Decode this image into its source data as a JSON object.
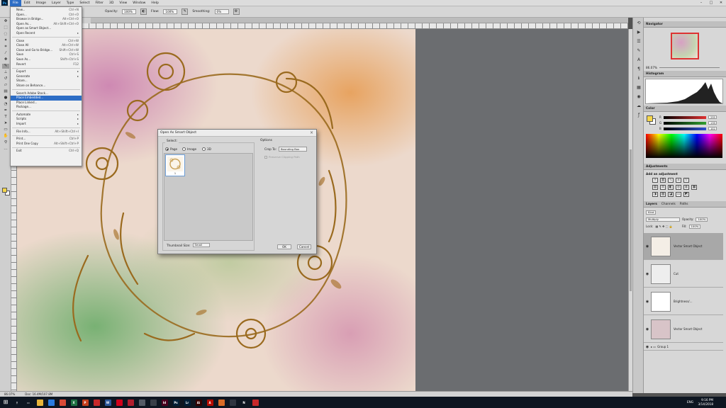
{
  "menubar": {
    "logo": "Ps",
    "items": [
      "File",
      "Edit",
      "Image",
      "Layer",
      "Type",
      "Select",
      "Filter",
      "3D",
      "View",
      "Window",
      "Help"
    ],
    "active_index": 0
  },
  "window_controls": {
    "minimize": "–",
    "maximize": "□",
    "close": "✕"
  },
  "options_bar": {
    "opacity_label": "Opacity:",
    "opacity_value": "100%",
    "flow_label": "Flow:",
    "flow_value": "100%",
    "smoothing_label": "Smoothing:",
    "smoothing_value": "0%"
  },
  "document_tab": "",
  "status_bar": {
    "zoom": "86.07%",
    "doc": "Doc: 16.4M/107.8M"
  },
  "file_menu": [
    {
      "label": "New...",
      "shortcut": "Ctrl+N"
    },
    {
      "label": "Open...",
      "shortcut": "Ctrl+O"
    },
    {
      "label": "Browse in Bridge...",
      "shortcut": "Alt+Ctrl+O"
    },
    {
      "label": "Open As...",
      "shortcut": "Alt+Shift+Ctrl+O"
    },
    {
      "label": "Open as Smart Object...",
      "shortcut": ""
    },
    {
      "label": "Open Recent",
      "shortcut": "▸"
    },
    {
      "sep": true
    },
    {
      "label": "Close",
      "shortcut": "Ctrl+W"
    },
    {
      "label": "Close All",
      "shortcut": "Alt+Ctrl+W"
    },
    {
      "label": "Close and Go to Bridge...",
      "shortcut": "Shift+Ctrl+W"
    },
    {
      "label": "Save",
      "shortcut": "Ctrl+S"
    },
    {
      "label": "Save As...",
      "shortcut": "Shift+Ctrl+S"
    },
    {
      "label": "Revert",
      "shortcut": "F12"
    },
    {
      "sep": true
    },
    {
      "label": "Export",
      "shortcut": "▸"
    },
    {
      "label": "Generate",
      "shortcut": "▸"
    },
    {
      "label": "Share...",
      "shortcut": ""
    },
    {
      "label": "Share on Behance...",
      "shortcut": ""
    },
    {
      "sep": true
    },
    {
      "label": "Search Adobe Stock...",
      "shortcut": ""
    },
    {
      "label": "Place Embedded...",
      "shortcut": "",
      "highlight": true
    },
    {
      "label": "Place Linked...",
      "shortcut": ""
    },
    {
      "label": "Package...",
      "shortcut": ""
    },
    {
      "sep": true
    },
    {
      "label": "Automate",
      "shortcut": "▸"
    },
    {
      "label": "Scripts",
      "shortcut": "▸"
    },
    {
      "label": "Import",
      "shortcut": "▸"
    },
    {
      "sep": true
    },
    {
      "label": "File Info...",
      "shortcut": "Alt+Shift+Ctrl+I"
    },
    {
      "sep": true
    },
    {
      "label": "Print...",
      "shortcut": "Ctrl+P"
    },
    {
      "label": "Print One Copy",
      "shortcut": "Alt+Shift+Ctrl+P"
    },
    {
      "sep": true
    },
    {
      "label": "Exit",
      "shortcut": "Ctrl+Q"
    }
  ],
  "dialog": {
    "title": "Open As Smart Object",
    "select_label": "Select:",
    "radios": [
      {
        "label": "Page",
        "checked": true
      },
      {
        "label": "Image",
        "checked": false
      },
      {
        "label": "3D",
        "checked": false
      }
    ],
    "thumb_number": "1",
    "thumb_size_label": "Thumbnail Size:",
    "thumb_size_value": "Small",
    "options_label": "Options",
    "crop_label": "Crop To:",
    "crop_value": "Bounding Box",
    "clip_label": "Preserve Clipping Path",
    "ok": "OK",
    "cancel": "Cancel"
  },
  "panels": {
    "navigator": {
      "title": "Navigator",
      "zoom": "86.07%"
    },
    "histogram": {
      "title": "Histogram"
    },
    "color": {
      "title": "Color",
      "rows": [
        {
          "label": "R",
          "value": "255",
          "color": "#e03030"
        },
        {
          "label": "G",
          "value": "255",
          "color": "#30a030"
        },
        {
          "label": "B",
          "value": "102",
          "color": "#3050d0"
        }
      ]
    },
    "adjustments": {
      "title": "Adjustments",
      "subtitle": "Add an adjustment"
    },
    "layers": {
      "tabs": [
        "Layers",
        "Channels",
        "Paths"
      ],
      "kind": "Kind",
      "blend": "Multiply",
      "opacity_label": "Opacity:",
      "opacity_value": "100%",
      "lock_label": "Lock:",
      "fill_label": "Fill:",
      "fill_value": "100%",
      "items": [
        {
          "name": "Vector Smart Object",
          "selected": true,
          "thumb": "#f4eee6"
        },
        {
          "name": "Cut",
          "selected": false,
          "thumb": "#eeeeee"
        },
        {
          "name": "Brightness/...",
          "selected": false,
          "thumb": "#ffffff"
        },
        {
          "name": "Vector Smart Object",
          "selected": false,
          "thumb": "#d8c4c8"
        },
        {
          "name": "Group 1",
          "selected": false,
          "thumb": ""
        }
      ]
    }
  },
  "taskbar": {
    "apps": [
      {
        "name": "search",
        "color": "#0e1621",
        "glyph": "⚲"
      },
      {
        "name": "task-view",
        "color": "#0e1621",
        "glyph": "▭"
      },
      {
        "name": "explorer",
        "color": "#e8b43a",
        "glyph": ""
      },
      {
        "name": "store",
        "color": "#2a7be0",
        "glyph": ""
      },
      {
        "name": "chrome",
        "color": "#d84a38",
        "glyph": ""
      },
      {
        "name": "excel",
        "color": "#1f7244",
        "glyph": "X"
      },
      {
        "name": "powerpoint",
        "color": "#c43e1c",
        "glyph": "P"
      },
      {
        "name": "app-red",
        "color": "#c7282a",
        "glyph": ""
      },
      {
        "name": "word",
        "color": "#2b579a",
        "glyph": "W"
      },
      {
        "name": "app-red2",
        "color": "#d0021b",
        "glyph": ""
      },
      {
        "name": "app-red3",
        "color": "#b11e2e",
        "glyph": ""
      },
      {
        "name": "app-dark",
        "color": "#555b66",
        "glyph": ""
      },
      {
        "name": "app-dark2",
        "color": "#3a3f48",
        "glyph": ""
      },
      {
        "name": "indesign",
        "color": "#49021f",
        "glyph": "Id"
      },
      {
        "name": "photoshop",
        "color": "#001e36",
        "glyph": "Ps"
      },
      {
        "name": "lightroom",
        "color": "#001e36",
        "glyph": "Lr"
      },
      {
        "name": "illustrator",
        "color": "#330000",
        "glyph": "Ai"
      },
      {
        "name": "acrobat",
        "color": "#b30b00",
        "glyph": "A"
      },
      {
        "name": "app-orange",
        "color": "#d86b27",
        "glyph": ""
      },
      {
        "name": "app-dark3",
        "color": "#2f3540",
        "glyph": ""
      },
      {
        "name": "netflix",
        "color": "#0e1621",
        "glyph": "N"
      },
      {
        "name": "app-red4",
        "color": "#c7282a",
        "glyph": ""
      }
    ],
    "lang": "ENG",
    "time": "9:16 PM",
    "date": "3/14/2018"
  }
}
